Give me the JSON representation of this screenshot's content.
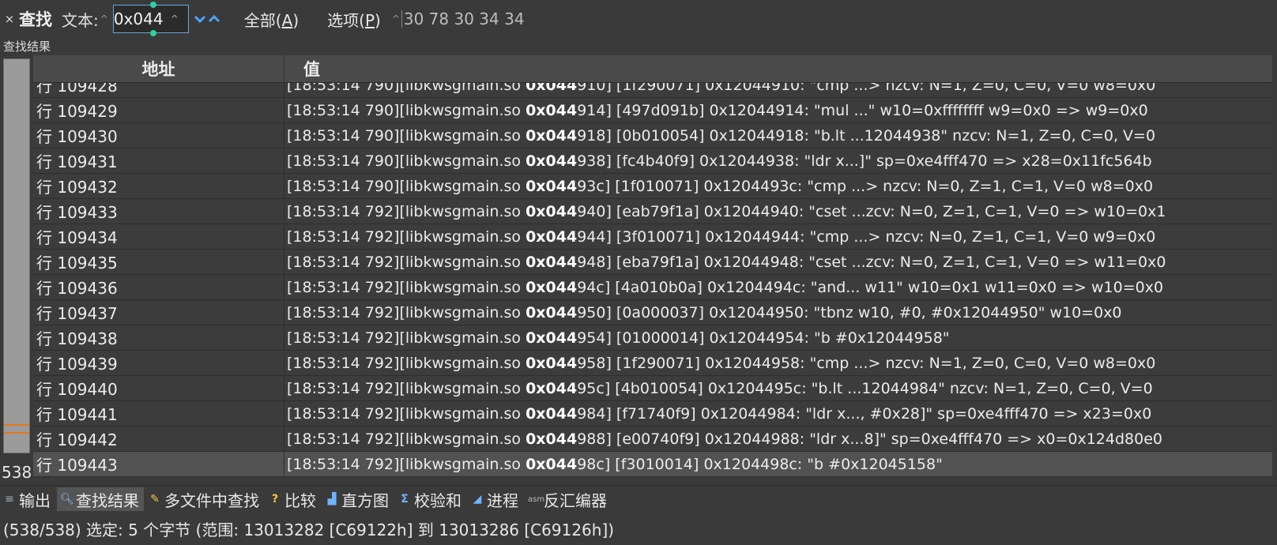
{
  "findbar": {
    "close_label": "×",
    "title": "查找",
    "text_label": "文本:",
    "search_value": "0x044",
    "all_label": "全部(",
    "all_key": "A",
    "all_close": ")",
    "options_label": "选项(",
    "options_key": "P",
    "options_close": ")",
    "hex_bytes": "30 78 30 34 34",
    "accent_color": "#4aa3ff"
  },
  "results_label": "查找结果",
  "overview": {
    "count": "538"
  },
  "table": {
    "columns": {
      "address": "地址",
      "value": "值"
    },
    "rows": [
      {
        "addr": "行 109428",
        "pre": "[18:53:14 790][libkwsgmain.so ",
        "hit": "0x044",
        "post": "910] [1f290071] 0x12044910: \"cmp ...> nzcv: N=1, Z=0, C=0, V=0 w8=0x0"
      },
      {
        "addr": "行 109429",
        "pre": "[18:53:14 790][libkwsgmain.so ",
        "hit": "0x044",
        "post": "914] [497d091b] 0x12044914: \"mul ...\" w10=0xffffffff w9=0x0 => w9=0x0"
      },
      {
        "addr": "行 109430",
        "pre": "[18:53:14 790][libkwsgmain.so ",
        "hit": "0x044",
        "post": "918] [0b010054] 0x12044918: \"b.lt ...12044938\" nzcv: N=1, Z=0, C=0, V=0"
      },
      {
        "addr": "行 109431",
        "pre": "[18:53:14 790][libkwsgmain.so ",
        "hit": "0x044",
        "post": "938] [fc4b40f9] 0x12044938: \"ldr x...]\" sp=0xe4fff470 => x28=0x11fc564b"
      },
      {
        "addr": "行 109432",
        "pre": "[18:53:14 790][libkwsgmain.so ",
        "hit": "0x044",
        "post": "93c] [1f010071] 0x1204493c: \"cmp ...> nzcv: N=0, Z=1, C=1, V=0 w8=0x0"
      },
      {
        "addr": "行 109433",
        "pre": "[18:53:14 792][libkwsgmain.so ",
        "hit": "0x044",
        "post": "940] [eab79f1a] 0x12044940: \"cset ...zcv: N=0, Z=1, C=1, V=0 => w10=0x1"
      },
      {
        "addr": "行 109434",
        "pre": "[18:53:14 792][libkwsgmain.so ",
        "hit": "0x044",
        "post": "944] [3f010071] 0x12044944: \"cmp ...> nzcv: N=0, Z=1, C=1, V=0 w9=0x0"
      },
      {
        "addr": "行 109435",
        "pre": "[18:53:14 792][libkwsgmain.so ",
        "hit": "0x044",
        "post": "948] [eba79f1a] 0x12044948: \"cset ...zcv: N=0, Z=1, C=1, V=0 => w11=0x0"
      },
      {
        "addr": "行 109436",
        "pre": "[18:53:14 792][libkwsgmain.so ",
        "hit": "0x044",
        "post": "94c] [4a010b0a] 0x1204494c: \"and... w11\" w10=0x1 w11=0x0 => w10=0x0"
      },
      {
        "addr": "行 109437",
        "pre": "[18:53:14 792][libkwsgmain.so ",
        "hit": "0x044",
        "post": "950] [0a000037] 0x12044950: \"tbnz w10, #0, #0x12044950\" w10=0x0"
      },
      {
        "addr": "行 109438",
        "pre": "[18:53:14 792][libkwsgmain.so ",
        "hit": "0x044",
        "post": "954] [01000014] 0x12044954: \"b #0x12044958\""
      },
      {
        "addr": "行 109439",
        "pre": "[18:53:14 792][libkwsgmain.so ",
        "hit": "0x044",
        "post": "958] [1f290071] 0x12044958: \"cmp ...> nzcv: N=1, Z=0, C=0, V=0 w8=0x0"
      },
      {
        "addr": "行 109440",
        "pre": "[18:53:14 792][libkwsgmain.so ",
        "hit": "0x044",
        "post": "95c] [4b010054] 0x1204495c: \"b.lt ...12044984\" nzcv: N=1, Z=0, C=0, V=0"
      },
      {
        "addr": "行 109441",
        "pre": "[18:53:14 792][libkwsgmain.so ",
        "hit": "0x044",
        "post": "984] [f71740f9] 0x12044984: \"ldr x..., #0x28]\" sp=0xe4fff470 => x23=0x0"
      },
      {
        "addr": "行 109442",
        "pre": "[18:53:14 792][libkwsgmain.so ",
        "hit": "0x044",
        "post": "988] [e00740f9] 0x12044988: \"ldr x...8]\" sp=0xe4fff470 => x0=0x124d80e0"
      },
      {
        "addr": "行 109443",
        "pre": "[18:53:14 792][libkwsgmain.so ",
        "hit": "0x044",
        "post": "98c] [f3010014] 0x1204498c: \"b #0x12045158\"",
        "selected": true
      }
    ]
  },
  "tabs": [
    {
      "label": "输出",
      "icon": "output-icon"
    },
    {
      "label": "查找结果",
      "icon": "find-results-icon",
      "active": true
    },
    {
      "label": "多文件中查找",
      "icon": "find-in-files-icon"
    },
    {
      "label": "比较",
      "icon": "compare-icon"
    },
    {
      "label": "直方图",
      "icon": "histogram-icon"
    },
    {
      "label": "校验和",
      "icon": "checksum-icon"
    },
    {
      "label": "进程",
      "icon": "process-icon"
    },
    {
      "label": "反汇编器",
      "icon": "disassembler-icon"
    }
  ],
  "status": "(538/538) 选定: 5 个字节 (范围: 13013282 [C69122h] 到 13013286 [C69126h])"
}
